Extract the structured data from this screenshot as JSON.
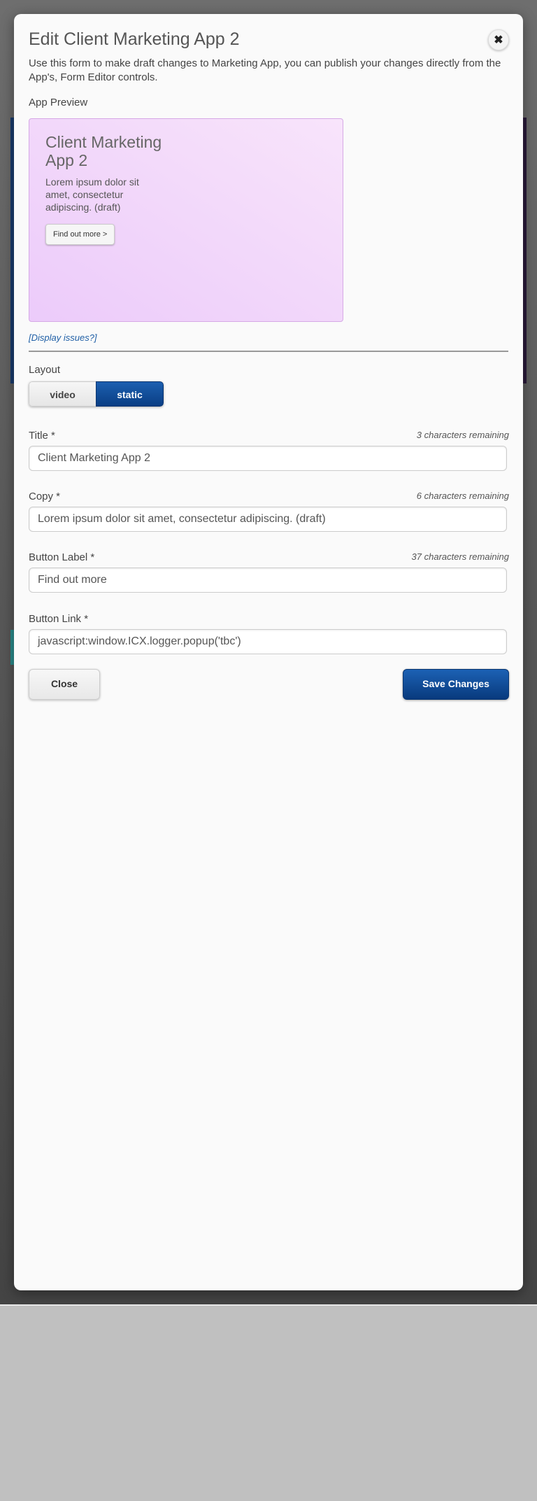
{
  "modal": {
    "title": "Edit Client Marketing App 2",
    "close_icon": "✖",
    "intro": "Use this form to make draft changes to Marketing App, you can publish your changes directly from the App's, Form Editor controls."
  },
  "preview": {
    "label": "App Preview",
    "heading": "Client Marketing App 2",
    "copy": "Lorem ipsum dolor sit amet, consectetur adipiscing. (draft)",
    "button": "Find out more >",
    "background_color": "#f0d4fa",
    "display_issues": "[Display issues?]"
  },
  "layout": {
    "label": "Layout",
    "options": [
      "video",
      "static"
    ],
    "selected": "static"
  },
  "fields": {
    "title": {
      "label": "Title *",
      "remaining": "3 characters remaining",
      "value": "Client Marketing App 2"
    },
    "copy": {
      "label": "Copy *",
      "remaining": "6 characters remaining",
      "value": "Lorem ipsum dolor sit amet, consectetur adipiscing. (draft)"
    },
    "button_label": {
      "label": "Button Label *",
      "remaining": "37 characters remaining",
      "value": "Find out more"
    },
    "button_link": {
      "label": "Button Link *",
      "value": "javascript:window.ICX.logger.popup('tbc')"
    }
  },
  "actions": {
    "close": "Close",
    "save": "Save Changes"
  },
  "colors": {
    "primary": "#0a3e84",
    "link": "#1f5fa6"
  }
}
